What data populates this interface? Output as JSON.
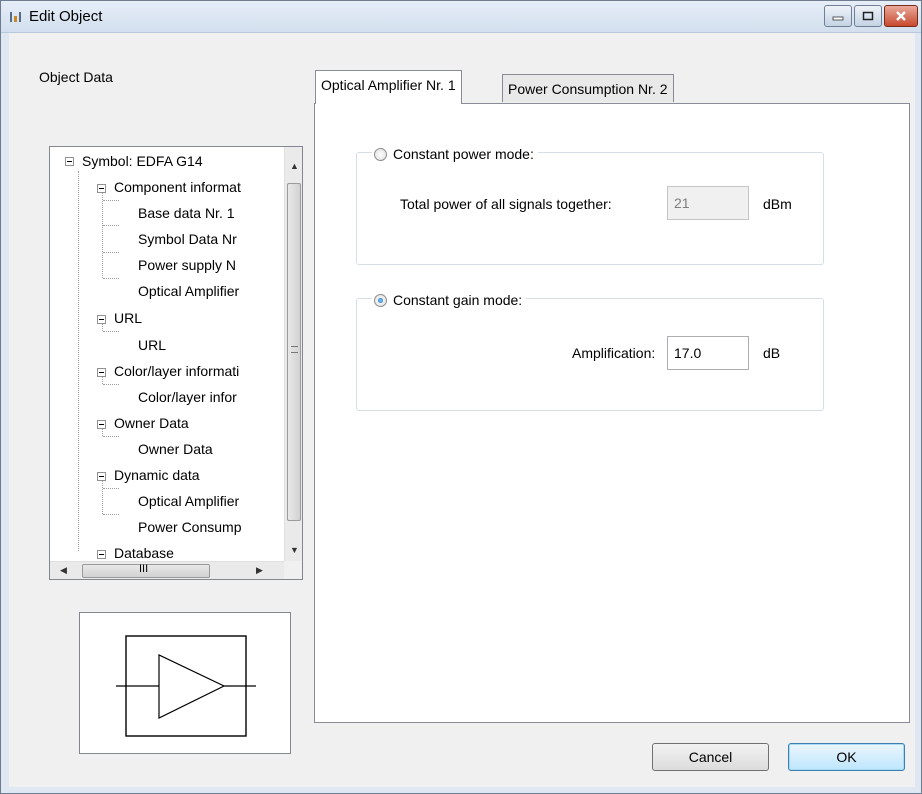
{
  "window": {
    "title": "Edit Object",
    "controls": {
      "minimize": "minimize-icon",
      "maximize": "maximize-icon",
      "close": "close-icon"
    }
  },
  "object_data_label": "Object Data",
  "tree": {
    "root": "Symbol: EDFA G14",
    "nodes": [
      {
        "label": "Component informat"
      },
      {
        "label": "Base data Nr. 1"
      },
      {
        "label": "Symbol Data Nr"
      },
      {
        "label": "Power supply N"
      },
      {
        "label": "Optical Amplifier"
      },
      {
        "label": "URL"
      },
      {
        "label": "URL"
      },
      {
        "label": "Color/layer informati"
      },
      {
        "label": "Color/layer infor"
      },
      {
        "label": "Owner Data"
      },
      {
        "label": "Owner Data"
      },
      {
        "label": "Dynamic data"
      },
      {
        "label": "Optical Amplifier"
      },
      {
        "label": "Power Consump"
      },
      {
        "label": "Database"
      }
    ],
    "hscroll_grip": "III"
  },
  "tabs": [
    {
      "label": "Optical Amplifier Nr. 1",
      "active": true
    },
    {
      "label": "Power Consumption Nr. 2",
      "active": false
    }
  ],
  "power_mode": {
    "label": "Constant power mode:",
    "selected": false,
    "field_label": "Total power of all signals together:",
    "value": "21",
    "unit": "dBm"
  },
  "gain_mode": {
    "label": "Constant gain mode:",
    "selected": true,
    "field_label": "Amplification:",
    "value": "17.0",
    "unit": "dB"
  },
  "buttons": {
    "cancel": "Cancel",
    "ok": "OK"
  },
  "colors": {
    "window_bg": "#dfe8f2",
    "dialog_bg": "#f0f0f0",
    "radio_selected": "#0d5db4"
  }
}
